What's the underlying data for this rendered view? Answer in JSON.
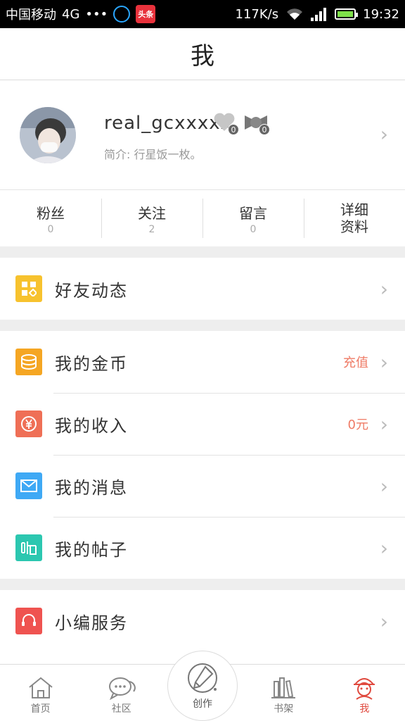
{
  "status_bar": {
    "carrier": "中国移动",
    "network": "4G",
    "dots": "•••",
    "news_app": "头条",
    "speed": "117K/s",
    "time": "19:32"
  },
  "header": {
    "title": "我"
  },
  "profile": {
    "username": "real_gcxxxxx",
    "bio": "简介: 行星饭一枚。",
    "badges": [
      {
        "icon": "heart-badge-icon",
        "count": "0"
      },
      {
        "icon": "bow-badge-icon",
        "count": "0"
      }
    ]
  },
  "stats": [
    {
      "label": "粉丝",
      "value": "0"
    },
    {
      "label": "关注",
      "value": "2"
    },
    {
      "label": "留言",
      "value": "0"
    },
    {
      "label_line1": "详细",
      "label_line2": "资料"
    }
  ],
  "menu": {
    "friends": {
      "title": "好友动态",
      "icon": "grid-icon",
      "color": "#f7c22e"
    },
    "coins": {
      "title": "我的金币",
      "extra": "充值",
      "icon": "coins-icon",
      "color": "#f5a623"
    },
    "income": {
      "title": "我的收入",
      "extra": "0元",
      "icon": "yen-icon",
      "color": "#ef6f56"
    },
    "messages": {
      "title": "我的消息",
      "icon": "mail-icon",
      "color": "#3fa9f5"
    },
    "posts": {
      "title": "我的帖子",
      "icon": "post-icon",
      "color": "#2cc7b0"
    },
    "service": {
      "title": "小编服务",
      "icon": "headset-icon",
      "color": "#ef5350"
    }
  },
  "tabbar": {
    "tabs": [
      {
        "label": "首页",
        "icon": "home-icon"
      },
      {
        "label": "社区",
        "icon": "chat-icon"
      },
      {
        "label": "创作",
        "icon": "pen-icon"
      },
      {
        "label": "书架",
        "icon": "bookshelf-icon"
      },
      {
        "label": "我",
        "icon": "me-icon",
        "active": true
      }
    ]
  },
  "colors": {
    "accent": "#e04a3f",
    "extra_text": "#ef7b66"
  }
}
